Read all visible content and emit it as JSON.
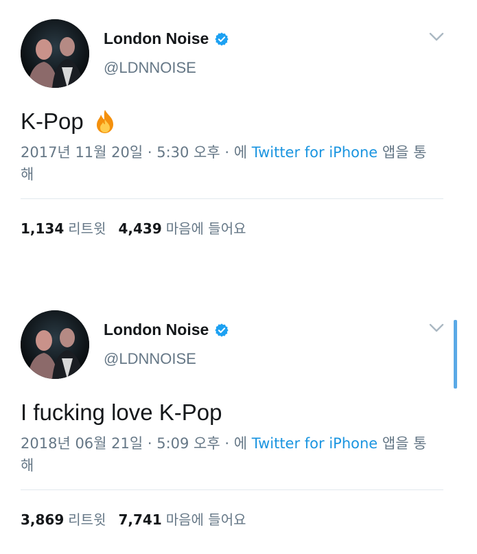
{
  "tweets": [
    {
      "name": "London Noise",
      "handle": "@LDNNOISE",
      "text": "K-Pop",
      "has_fire_emoji": true,
      "meta_prefix": "2017년 11월 20일 · 5:30 오후 · 에 ",
      "source": "Twitter for iPhone",
      "meta_suffix": " 앱을 통해",
      "retweets_count": "1,134",
      "retweets_label": "리트윗",
      "likes_count": "4,439",
      "likes_label": "마음에 들어요"
    },
    {
      "name": "London Noise",
      "handle": "@LDNNOISE",
      "text": "I fucking love K-Pop",
      "has_fire_emoji": false,
      "meta_prefix": "2018년 06월 21일 · 5:09 오후 · 에 ",
      "source": "Twitter for iPhone",
      "meta_suffix": " 앱을 통해",
      "retweets_count": "3,869",
      "retweets_label": "리트윗",
      "likes_count": "7,741",
      "likes_label": "마음에 들어요"
    }
  ],
  "icons": {
    "verified": "verified-badge-icon",
    "menu": "chevron-down-icon",
    "emoji": "fire-emoji-icon"
  },
  "colors": {
    "verified_blue": "#1da1f2",
    "link_blue": "#1b95e0",
    "secondary_text": "#657786",
    "primary_text": "#14171a",
    "divider": "#e1e8ed"
  }
}
